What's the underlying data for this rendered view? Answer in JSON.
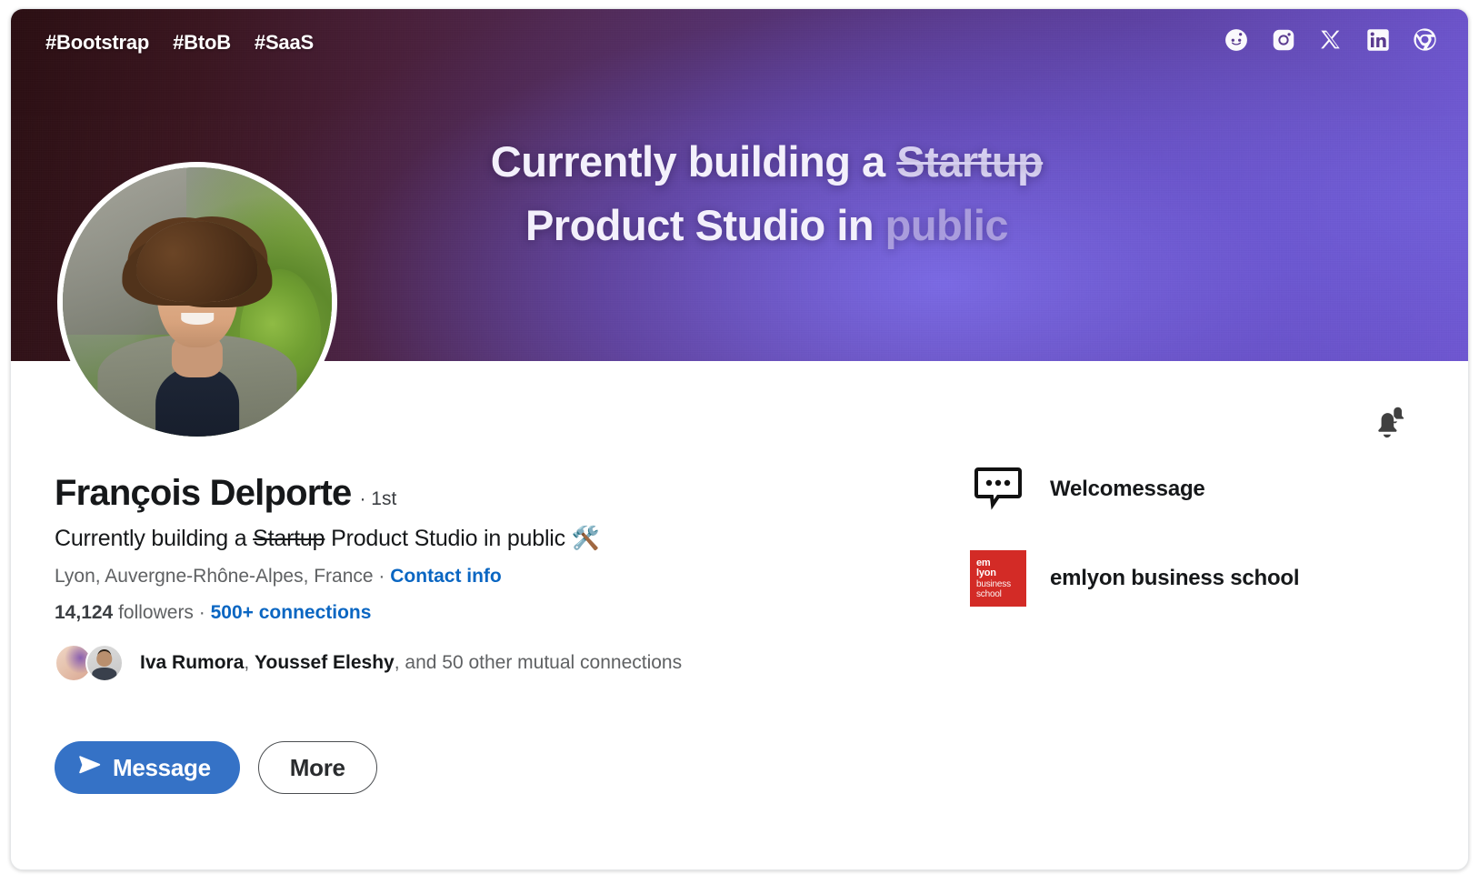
{
  "banner": {
    "hashtags": [
      "#Bootstrap",
      "#BtoB",
      "#SaaS"
    ],
    "headline_pre": "Currently building a ",
    "headline_strike": "Startup",
    "headline_mid": " Product Studio in ",
    "headline_dim": "public",
    "gradient_start": "#2b0f13",
    "gradient_end": "#7356d6",
    "socials": [
      {
        "name": "reddit-icon",
        "label": "Reddit"
      },
      {
        "name": "instagram-icon",
        "label": "Instagram"
      },
      {
        "name": "x-twitter-icon",
        "label": "X"
      },
      {
        "name": "linkedin-icon",
        "label": "LinkedIn"
      },
      {
        "name": "chrome-icon",
        "label": "Chrome"
      }
    ]
  },
  "profile": {
    "name": "François Delporte",
    "degree": "· 1st",
    "headline_pre": "Currently building a ",
    "headline_strike": "Startup",
    "headline_post": " Product Studio in public 🛠️",
    "location": "Lyon, Auvergne-Rhône-Alpes, France · ",
    "contact_info": "Contact info",
    "followers_count": "14,124",
    "followers_label": " followers  · ",
    "connections": "500+ connections",
    "mutuals_name_1": "Iva Rumora",
    "mutuals_sep": ", ",
    "mutuals_name_2": "Youssef Eleshy",
    "mutuals_rest": ", and 50 other mutual connections",
    "accent_color": "#0a66c2"
  },
  "actions": {
    "message_label": "Message",
    "more_label": "More",
    "message_bg": "#3572c6"
  },
  "organizations": [
    {
      "name": "Welcomessage",
      "logo": "speech-bubble-logo"
    },
    {
      "name": "emlyon business school",
      "logo": "emlyon-logo",
      "logo_color": "#d32b26",
      "logo_lines": [
        "em",
        "lyon",
        "business",
        "school"
      ]
    }
  ],
  "notifications": {
    "icon": "bell-icon"
  }
}
